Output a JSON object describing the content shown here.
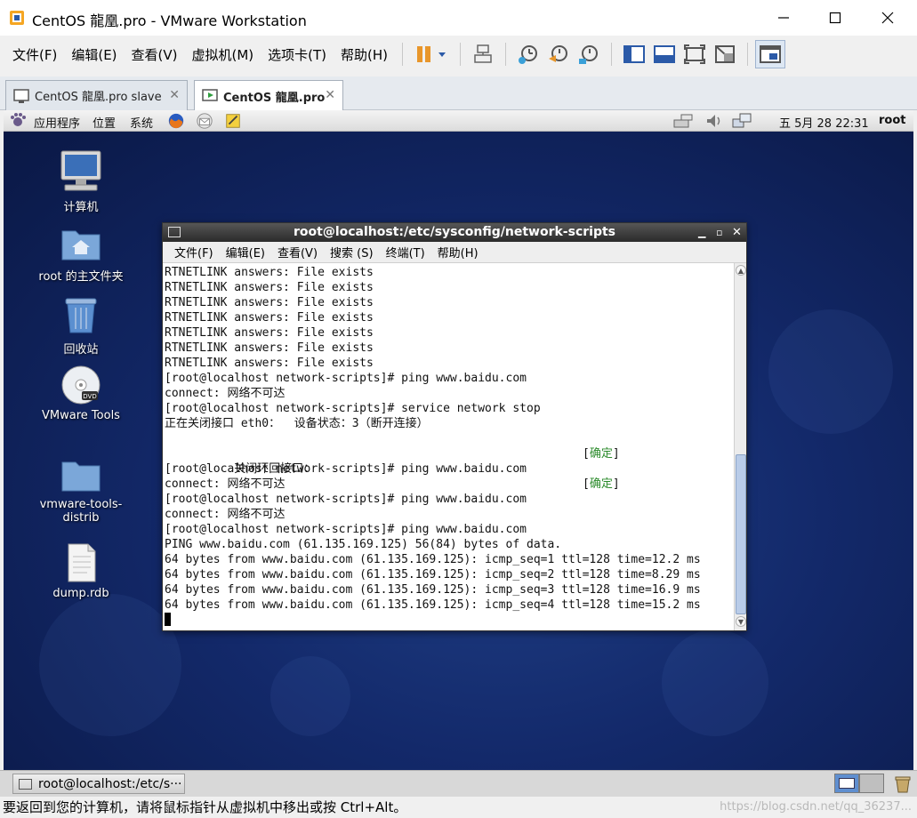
{
  "window": {
    "title": "CentOS 龍凰.pro - VMware Workstation"
  },
  "menu": [
    "文件(F)",
    "编辑(E)",
    "查看(V)",
    "虚拟机(M)",
    "选项卡(T)",
    "帮助(H)"
  ],
  "tabs": [
    {
      "label": "CentOS 龍凰.pro slave",
      "active": false
    },
    {
      "label": "CentOS 龍凰.pro",
      "active": true
    }
  ],
  "gnome_panel": {
    "apps": "应用程序",
    "places": "位置",
    "system": "系统",
    "datetime": "五  5月 28 22:31",
    "user": "root"
  },
  "desktop_icons": [
    {
      "label": "计算机",
      "icon": "computer-icon"
    },
    {
      "label": "root 的主文件夹",
      "icon": "home-folder-icon"
    },
    {
      "label": "回收站",
      "icon": "trash-icon"
    },
    {
      "label": "VMware Tools",
      "icon": "dvd-icon"
    },
    {
      "label": "vmware-tools-distrib",
      "icon": "folder-icon"
    },
    {
      "label": "dump.rdb",
      "icon": "file-icon"
    }
  ],
  "terminal": {
    "title": "root@localhost:/etc/sysconfig/network-scripts",
    "menu": [
      "文件(F)",
      "编辑(E)",
      "查看(V)",
      "搜索 (S)",
      "终端(T)",
      "帮助(H)"
    ],
    "lines": [
      "RTNETLINK answers: File exists",
      "RTNETLINK answers: File exists",
      "RTNETLINK answers: File exists",
      "RTNETLINK answers: File exists",
      "RTNETLINK answers: File exists",
      "RTNETLINK answers: File exists",
      "RTNETLINK answers: File exists",
      "[root@localhost network-scripts]# ping www.baidu.com",
      "connect: 网络不可达",
      "[root@localhost network-scripts]# service network stop",
      "正在关闭接口 eth0：  设备状态：3（断开连接）",
      "",
      "关闭环回接口：",
      "[root@localhost network-scripts]# ping www.baidu.com",
      "connect: 网络不可达",
      "[root@localhost network-scripts]# ping www.baidu.com",
      "connect: 网络不可达",
      "[root@localhost network-scripts]# ping www.baidu.com",
      "PING www.baidu.com (61.135.169.125) 56(84) bytes of data.",
      "64 bytes from www.baidu.com (61.135.169.125): icmp_seq=1 ttl=128 time=12.2 ms",
      "64 bytes from www.baidu.com (61.135.169.125): icmp_seq=2 ttl=128 time=8.29 ms",
      "64 bytes from www.baidu.com (61.135.169.125): icmp_seq=3 ttl=128 time=16.9 ms",
      "64 bytes from www.baidu.com (61.135.169.125): icmp_seq=4 ttl=128 time=15.2 ms"
    ],
    "ok_left": "[",
    "ok_text": "确定",
    "ok_right": "]"
  },
  "taskbar": {
    "terminal_task": "root@localhost:/etc/s···"
  },
  "statusbar": {
    "text": "要返回到您的计算机，请将鼠标指针从虚拟机中移出或按 Ctrl+Alt。",
    "watermark": "https://blog.csdn.net/qq_36237..."
  },
  "colors": {
    "desktop": "#13296a",
    "ok_green": "#2a8a2a",
    "terminal_title": "#3a3a3a"
  }
}
